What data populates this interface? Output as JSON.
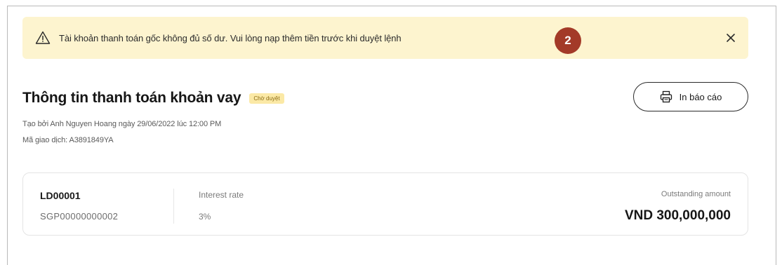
{
  "alert": {
    "message": "Tài khoản thanh toán gốc không đủ số dư. Vui lòng nạp thêm tiền trước khi duyệt lệnh",
    "step_number": "2",
    "icon": "warning-icon",
    "close_icon": "close-icon",
    "background": "#fdf4cf",
    "badge_color": "#a33a28"
  },
  "header": {
    "title": "Thông tin thanh toán khoản vay",
    "status": "Chờ duyệt",
    "print_label": "In báo cáo",
    "print_icon": "printer-icon"
  },
  "meta": {
    "created": "Tạo bởi Anh Nguyen Hoang ngày 29/06/2022 lúc 12:00 PM",
    "transaction": "Mã giao dịch: A3891849YA"
  },
  "loan": {
    "id": "LD00001",
    "account": "SGP00000000002",
    "interest_label": "Interest rate",
    "interest_value": "3%",
    "outstanding_label": "Outstanding amount",
    "outstanding_value": "VND 300,000,000"
  }
}
